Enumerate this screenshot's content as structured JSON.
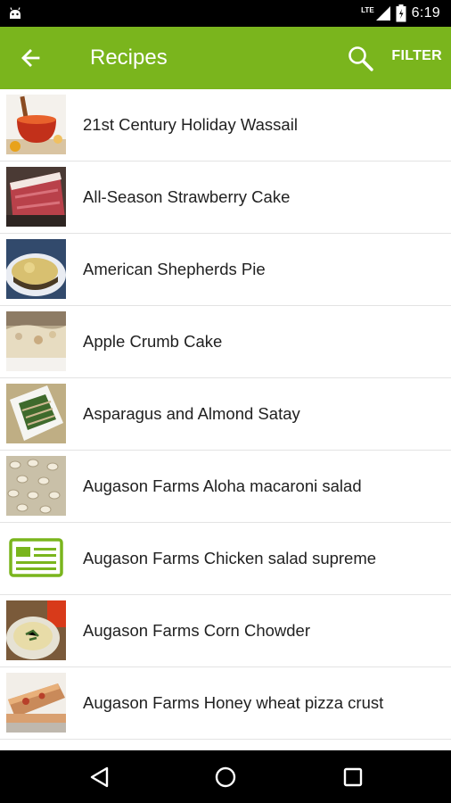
{
  "status_bar": {
    "network_label": "LTE",
    "time": "6:19"
  },
  "app_bar": {
    "title": "Recipes",
    "filter_label": "FILTER",
    "color": "#7ab51d"
  },
  "recipes": [
    {
      "name": "21st Century Holiday Wassail",
      "thumb": "wassail-photo"
    },
    {
      "name": "All-Season Strawberry Cake",
      "thumb": "strawberry-cake-photo"
    },
    {
      "name": "American Shepherds Pie",
      "thumb": "shepherds-pie-photo"
    },
    {
      "name": "Apple Crumb Cake",
      "thumb": "apple-crumb-cake-photo"
    },
    {
      "name": "Asparagus and Almond Satay",
      "thumb": "asparagus-satay-photo"
    },
    {
      "name": "Augason Farms Aloha macaroni salad",
      "thumb": "macaroni-salad-photo"
    },
    {
      "name": "Augason Farms Chicken salad supreme",
      "thumb": "recipe-placeholder-icon"
    },
    {
      "name": "Augason Farms Corn Chowder",
      "thumb": "corn-chowder-photo"
    },
    {
      "name": "Augason Farms Honey wheat pizza crust",
      "thumb": "pizza-crust-photo"
    }
  ],
  "nav_bar": {
    "back": "back-triangle-icon",
    "home": "home-circle-icon",
    "recents": "recents-square-icon"
  }
}
